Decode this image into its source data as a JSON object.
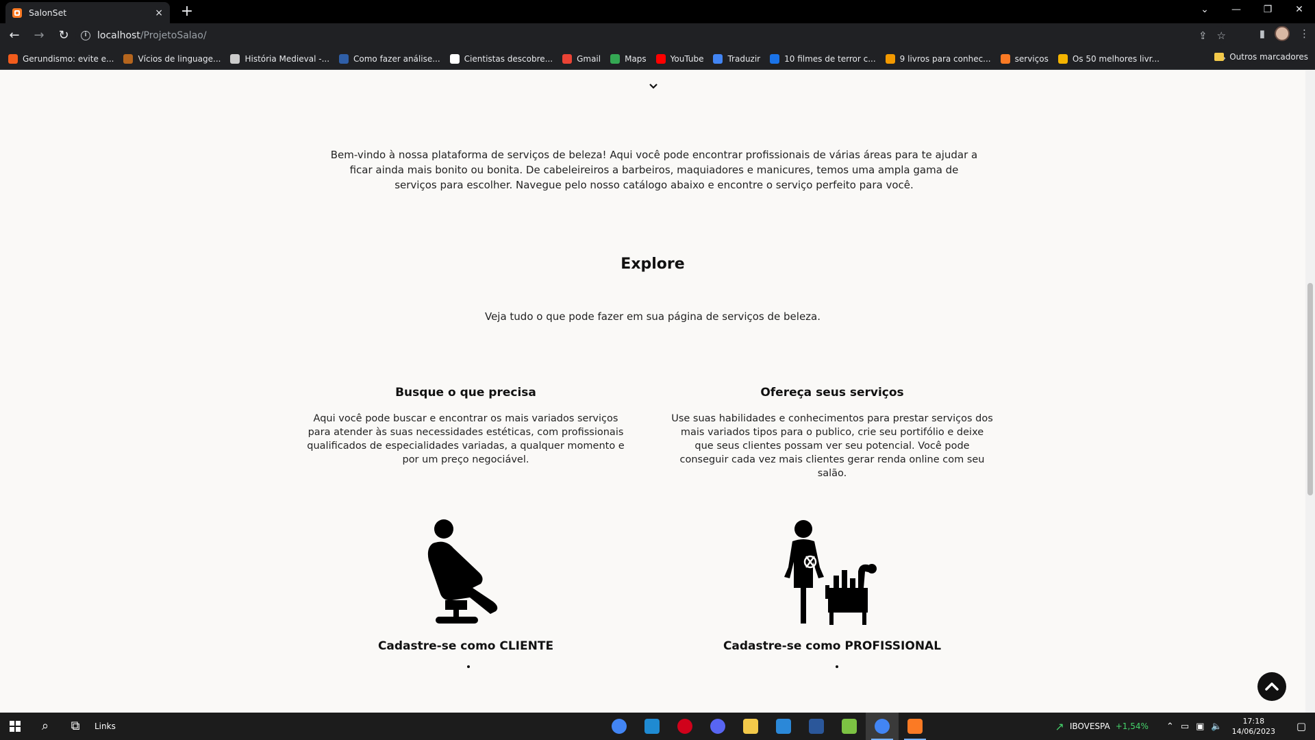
{
  "browser": {
    "tab_title": "SalonSet",
    "tab_close": "×",
    "new_tab": "+",
    "url_host": "localhost",
    "url_path": "/ProjetoSalao/",
    "window_controls": [
      "⌄",
      "—",
      "❐",
      "✕"
    ],
    "bookmarks": [
      {
        "label": "Gerundismo: evite e...",
        "color": "#f25c1c"
      },
      {
        "label": "Vícios de linguage...",
        "color": "#b5651d"
      },
      {
        "label": "História Medieval -...",
        "color": "#cccccc"
      },
      {
        "label": "Como fazer análise...",
        "color": "#2f5fa8"
      },
      {
        "label": "Cientistas descobre...",
        "color": "#ffffff"
      },
      {
        "label": "Gmail",
        "color": "#ea4335"
      },
      {
        "label": "Maps",
        "color": "#34a853"
      },
      {
        "label": "YouTube",
        "color": "#ff0000"
      },
      {
        "label": "Traduzir",
        "color": "#4285f4"
      },
      {
        "label": "10 filmes de terror c...",
        "color": "#1a73e8"
      },
      {
        "label": "9 livros para conhec...",
        "color": "#f29900"
      },
      {
        "label": "serviços",
        "color": "#fb7a24"
      },
      {
        "label": "Os 50 melhores livr...",
        "color": "#f4b400"
      }
    ],
    "bookmarks_more": "»",
    "other_bookmarks": "Outros marcadores"
  },
  "page": {
    "intro": "Bem-vindo à nossa plataforma de serviços de beleza! Aqui você pode encontrar profissionais de várias áreas para te ajudar a ficar ainda mais bonito ou bonita. De cabeleireiros a barbeiros, maquiadores e manicures, temos uma ampla gama de serviços para escolher. Navegue pelo nosso catálogo abaixo e encontre o serviço perfeito para você.",
    "explore_title": "Explore",
    "explore_subtitle": "Veja tudo o que pode fazer em sua página de serviços de beleza.",
    "left": {
      "heading": "Busque o que precisa",
      "text": "Aqui você pode buscar e encontrar os mais variados serviços para atender às suas necessidades estéticas, com profissionais qualificados de especialidades variadas, a qualquer momento e por um preço negociável.",
      "cta": "Cadastre-se como CLIENTE"
    },
    "right": {
      "heading": "Ofereça seus serviços",
      "text": "Use suas habilidades e conhecimentos para prestar serviços dos mais variados tipos para o publico, crie seu portifólio e deixe que seus clientes possam ver seu potencial. Você pode conseguir cada vez mais clientes gerar renda online com seu salão.",
      "cta": "Cadastre-se como PROFISSIONAL"
    }
  },
  "taskbar": {
    "links_label": "Links",
    "apps": [
      {
        "name": "chrome",
        "color": "#4285f4"
      },
      {
        "name": "vscode",
        "color": "#1f8ad2"
      },
      {
        "name": "opera",
        "color": "#d0021b"
      },
      {
        "name": "discord",
        "color": "#5865f2"
      },
      {
        "name": "file-explorer",
        "color": "#f3c94a"
      },
      {
        "name": "store",
        "color": "#2b88d8"
      },
      {
        "name": "word",
        "color": "#2b579a"
      },
      {
        "name": "bluestacks",
        "color": "#7cc243"
      },
      {
        "name": "chrome-profile",
        "color": "#4285f4"
      },
      {
        "name": "xampp",
        "color": "#fb7a24"
      }
    ],
    "ibov_label": "IBOVESPA",
    "ibov_value": "+1,54%",
    "time": "17:18",
    "date": "14/06/2023"
  }
}
